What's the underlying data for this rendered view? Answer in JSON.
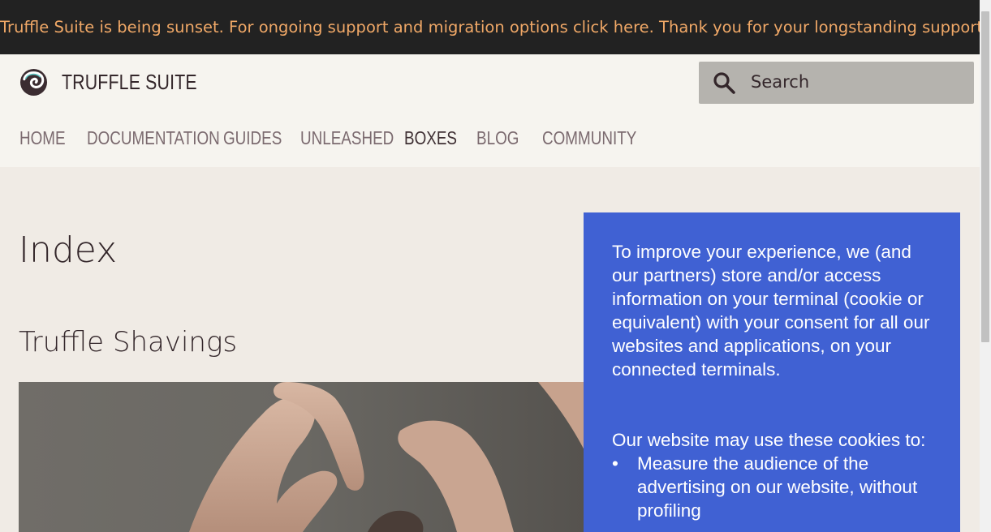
{
  "banner": {
    "text": "Truffle Suite is being sunset. For ongoing support and migration options click here. Thank you for your longstanding support."
  },
  "header": {
    "brand": "TRUFFLE SUITE",
    "logo_icon": "truffle-swirl-icon",
    "search": {
      "label": "Search",
      "icon": "search-icon"
    }
  },
  "nav": {
    "items": [
      {
        "label": "HOME"
      },
      {
        "label": "DOCUMENTATION"
      },
      {
        "label": "GUIDES"
      },
      {
        "label": "UNLEASHED"
      },
      {
        "label": "BOXES",
        "active": true
      },
      {
        "label": "BLOG"
      },
      {
        "label": "COMMUNITY"
      }
    ]
  },
  "content": {
    "title": "Index",
    "subtitle": "Truffle Shavings"
  },
  "cookie": {
    "paragraph1": "To improve your experience, we (and our partners) store and/or access information on your terminal (cookie or equivalent) with your consent for all our websites and applications, on your connected terminals.",
    "paragraph2": "Our website may use these cookies to:",
    "bullet_symbol": "•",
    "bullets": [
      "Measure the audience of the advertising on our website, without profiling"
    ]
  },
  "colors": {
    "banner_bg": "#222222",
    "banner_text": "#f0a867",
    "cookie_bg": "#4061d3",
    "page_bg": "#f0ebe5"
  }
}
